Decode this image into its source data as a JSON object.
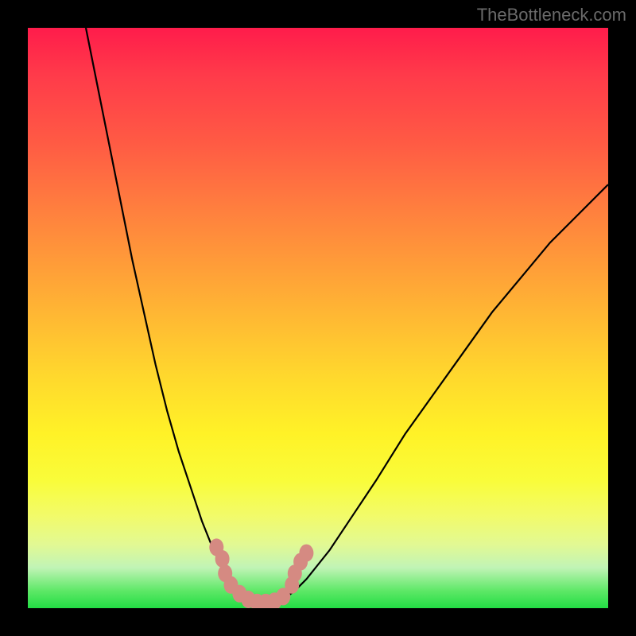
{
  "watermark": "TheBottleneck.com",
  "chart_data": {
    "type": "line",
    "title": "",
    "xlabel": "",
    "ylabel": "",
    "xlim": [
      0,
      100
    ],
    "ylim": [
      0,
      100
    ],
    "colors": {
      "gradient_top": "#ff1c4b",
      "gradient_mid": "#ffd82d",
      "gradient_bottom": "#22dd44",
      "curve": "#000000",
      "marker": "#d58a82"
    },
    "curve_points": [
      {
        "x": 10,
        "y": 100
      },
      {
        "x": 12,
        "y": 90
      },
      {
        "x": 14,
        "y": 80
      },
      {
        "x": 16,
        "y": 70
      },
      {
        "x": 18,
        "y": 60
      },
      {
        "x": 20,
        "y": 51
      },
      {
        "x": 22,
        "y": 42
      },
      {
        "x": 24,
        "y": 34
      },
      {
        "x": 26,
        "y": 27
      },
      {
        "x": 28,
        "y": 21
      },
      {
        "x": 30,
        "y": 15
      },
      {
        "x": 32,
        "y": 10
      },
      {
        "x": 34,
        "y": 6
      },
      {
        "x": 36,
        "y": 3
      },
      {
        "x": 38,
        "y": 1
      },
      {
        "x": 40,
        "y": 0.3
      },
      {
        "x": 42,
        "y": 0.5
      },
      {
        "x": 44,
        "y": 1.5
      },
      {
        "x": 46,
        "y": 3
      },
      {
        "x": 48,
        "y": 5
      },
      {
        "x": 52,
        "y": 10
      },
      {
        "x": 56,
        "y": 16
      },
      {
        "x": 60,
        "y": 22
      },
      {
        "x": 65,
        "y": 30
      },
      {
        "x": 70,
        "y": 37
      },
      {
        "x": 75,
        "y": 44
      },
      {
        "x": 80,
        "y": 51
      },
      {
        "x": 85,
        "y": 57
      },
      {
        "x": 90,
        "y": 63
      },
      {
        "x": 95,
        "y": 68
      },
      {
        "x": 100,
        "y": 73
      }
    ],
    "marker_points": [
      {
        "x": 32.5,
        "y": 10.5
      },
      {
        "x": 33.5,
        "y": 8.5
      },
      {
        "x": 34.0,
        "y": 6.0
      },
      {
        "x": 35.0,
        "y": 4.0
      },
      {
        "x": 36.5,
        "y": 2.5
      },
      {
        "x": 38.0,
        "y": 1.5
      },
      {
        "x": 39.5,
        "y": 1.0
      },
      {
        "x": 41.0,
        "y": 1.0
      },
      {
        "x": 42.5,
        "y": 1.2
      },
      {
        "x": 44.0,
        "y": 2.0
      },
      {
        "x": 45.5,
        "y": 4.0
      },
      {
        "x": 46.0,
        "y": 6.0
      },
      {
        "x": 47.0,
        "y": 8.0
      },
      {
        "x": 48.0,
        "y": 9.5
      }
    ]
  }
}
